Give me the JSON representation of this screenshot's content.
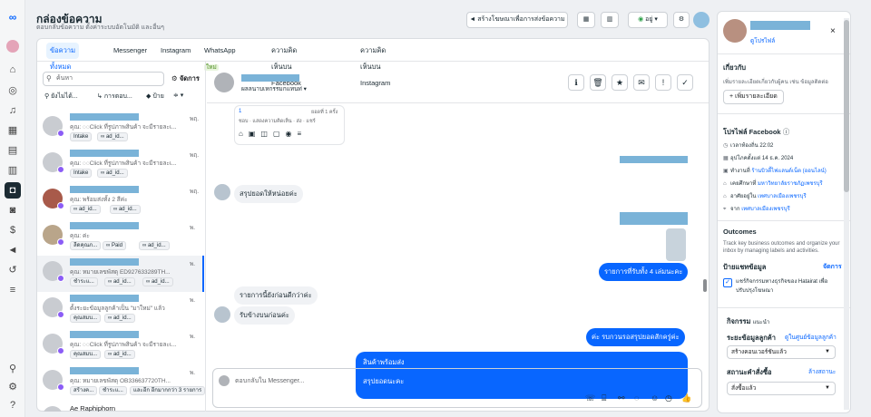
{
  "header": {
    "title": "กล่องข้อความ",
    "subtitle": "ตอบกลับข้อความ ตั้งค่าระบบอัตโนมัติ และอื่นๆ",
    "create_ad_label": "สร้างโฆษณาเพื่อการส่งข้อความ",
    "status_label": "อยู่"
  },
  "tabs": [
    {
      "label": "ข้อความทั้งหมด",
      "active": true
    },
    {
      "label": "Messenger"
    },
    {
      "label": "Instagram"
    },
    {
      "label": "WhatsApp",
      "badge": "ใหม่"
    },
    {
      "label": "ความคิดเห็นบน Facebook"
    },
    {
      "label": "ความคิดเห็นบน Instagram"
    }
  ],
  "list": {
    "search_placeholder": "ค้นหา",
    "manage_label": "จัดการ",
    "filters": [
      "ยังไม่ได้...",
      "การตอบ...",
      "ป้าย"
    ],
    "conversations": [
      {
        "time": "พฤ.",
        "preview": "คุณ: ◌◌Click ที่รูปภาพสินค้า จะมีรายละเ...",
        "tags": [
          "Intake",
          "ad_id..."
        ]
      },
      {
        "time": "พฤ.",
        "preview": "คุณ: ◌◌Click ที่รูปภาพสินค้า จะมีรายละเ...",
        "tags": [
          "Intake",
          "ad_id..."
        ]
      },
      {
        "time": "พฤ.",
        "preview": "คุณ: พร้อมส่งทั้ง 2 สีค่ะ",
        "tags": [
          "ad_id...",
          "ad_id..."
        ]
      },
      {
        "time": "พ.",
        "preview": "คุณ: ค่ะ",
        "tags": [
          "ลีดคุณภ...",
          "Paid",
          "ad_id..."
        ]
      },
      {
        "time": "พ.",
        "preview": "คุณ: หมายเลขพัสดุ ED927633289TH...",
        "tags": [
          "ชำระแ...",
          "ad_id...",
          "ad_id..."
        ]
      },
      {
        "time": "พ.",
        "preview": "ตั้งระยะข้อมูลลูกค้าเป็น \"มาใหม่\" แล้ว",
        "tags": [
          "คุณสมบ...",
          "ad_id..."
        ]
      },
      {
        "time": "พ.",
        "preview": "คุณ: ◌◌Click ที่รูปภาพสินค้า จะมีรายละเ...",
        "tags": [
          "คุณสมบ...",
          "ad_id..."
        ]
      },
      {
        "time": "พ.",
        "preview": "คุณ: หมายเลขพัสดุ OB336637720TH...",
        "tags": [
          "สร้างค...",
          "ชำระแ...",
          "และอีก อีกมากกว่า 3 รายการ"
        ]
      },
      {
        "time": "",
        "name_text": "Ae Raphiphorn",
        "preview": "",
        "tags": []
      }
    ]
  },
  "chat": {
    "status": "ผลลนาบเหกรรมกแทนท่",
    "messages": [
      {
        "side": "in",
        "text": "สรุปยอดให้หน่อยค่ะ"
      },
      {
        "side": "out",
        "text": "รายการที่รับทั้ง 4 เล่มนะคะ"
      },
      {
        "side": "in",
        "text": "รายการนี้ยังก่อนดีกว่าค่ะ"
      },
      {
        "side": "in",
        "text": "รับข้างบนก่อนค่ะ"
      },
      {
        "side": "out",
        "text": "ค่ะ รบกวนรอสรุปยอดสักครู่ค่ะ"
      },
      {
        "side": "out",
        "text": "สินค้าพร้อมส่ง"
      },
      {
        "side": "out",
        "text": "สรุปยอดนะคะ"
      }
    ],
    "preview_card": {
      "count": "1",
      "sub": "ยอดที่ 1 ครั้ง",
      "actions": [
        "ชอบ",
        "แสดงความคิดเห็น",
        "ส่ง",
        "แชร์"
      ]
    },
    "composer_placeholder": "ตอบกลับใน Messenger..."
  },
  "right": {
    "profile_link": "ดูโปรไฟล์",
    "about_title": "เกี่ยวกับ",
    "about_desc": "เพิ่มรายละเอียดเกี่ยวกับผู้คน เช่น ข้อมูลติดต่อ",
    "add_detail_label": "เพิ่มรายละเอียด",
    "fb_profile_title": "โปรไฟล์ Facebook",
    "fb_rows": [
      {
        "icon": "clock-icon",
        "text": "เวลาท้องถิ่น 22:02",
        "link": ""
      },
      {
        "icon": "calendar-icon",
        "text": "อุปโภคตั้งแต่ 14 ธ.ค. 2024",
        "link": ""
      },
      {
        "icon": "briefcase-icon",
        "text": "ทำงานที่ ",
        "link": "ร้านบิวตี้ไฟแลนด์เน็ต (ออนไลน์)"
      },
      {
        "icon": "school-icon",
        "text": "เคยศึกษาที่ ",
        "link": "มหาวิทยาลัยราชภัฏเพชรบุรี"
      },
      {
        "icon": "home-icon",
        "text": "อาศัยอยู่ใน ",
        "link": "เทศบาลเมืองเพชรบุรี"
      },
      {
        "icon": "pin-icon",
        "text": "จาก ",
        "link": "เทศบาลเมืองเพชรบุรี"
      }
    ],
    "outcomes_title": "Outcomes",
    "outcomes_desc1": "Track key business outcomes and organize your",
    "outcomes_desc2": "inbox by managing labels and activities.",
    "chat_labels_title": "ป้ายแชทข้อมูล",
    "chat_labels_manage": "จัดการ",
    "consent_text1": "แชร์กิจกรรมทางธุรกิจของ Hatairat เพื่อ",
    "consent_text2": "ปรับปรุงโฆษณา",
    "activity_title": "กิจกรรม",
    "activity_more": "แนะนำ",
    "stage_title": "ระยะข้อมูลลูกค้า",
    "stage_link": "ดูในศูนย์ข้อมูลลูกค้า",
    "stage_value": "สร้างคอนเวอร์ชันแล้ว",
    "order_title": "สถานะคำสั่งซื้อ",
    "order_link": "ล้างสถานะ",
    "order_value": "สั่งซื้อแล้ว"
  }
}
